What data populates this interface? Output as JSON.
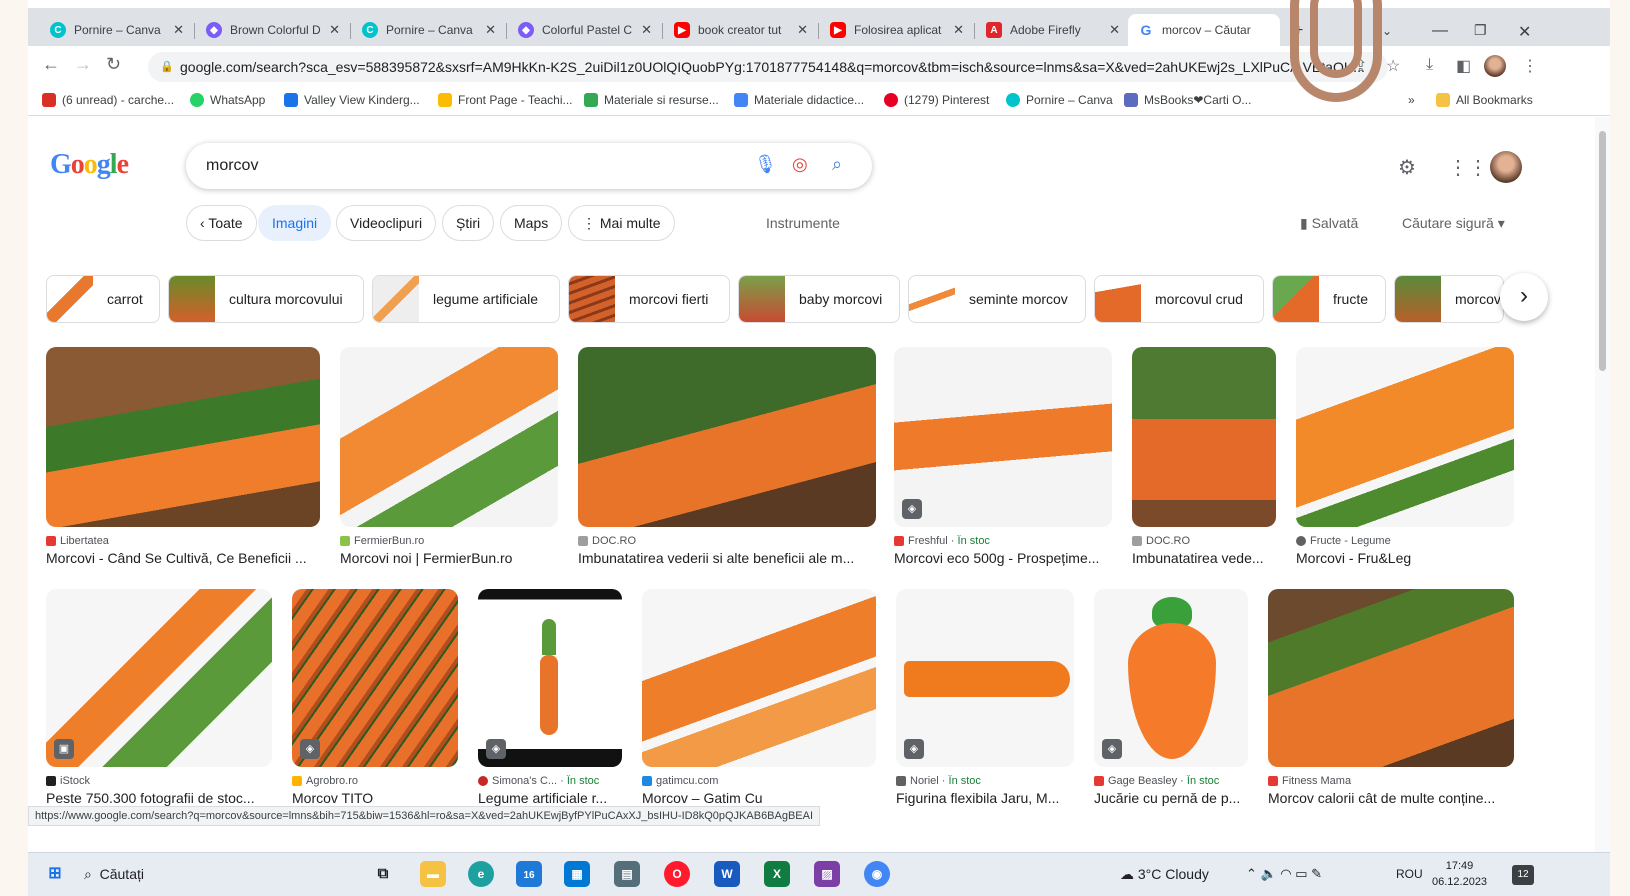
{
  "browser": {
    "tabs": [
      {
        "title": "Pornire – Canva",
        "icon_color": "#00c4cc"
      },
      {
        "title": "Brown Colorful D",
        "icon_color": "#7b5cf6"
      },
      {
        "title": "Pornire – Canva",
        "icon_color": "#00c4cc"
      },
      {
        "title": "Colorful Pastel C",
        "icon_color": "#7b5cf6"
      },
      {
        "title": "book creator tut",
        "icon_color": "#ff0000"
      },
      {
        "title": "Folosirea aplicat",
        "icon_color": "#ff0000"
      },
      {
        "title": "Adobe Firefly",
        "icon_color": "#e0262b"
      },
      {
        "title": "morcov – Căutar",
        "icon_color": "#4285f4",
        "active": true
      }
    ],
    "new_tab": "+",
    "url": "google.com/search?sca_esv=588395872&sxsrf=AM9HkKn-K2S_2uiDil1z0UOlQIQuobPYg:1701877754148&q=morcov&tbm=isch&source=lnms&sa=X&ved=2ahUKEwj2s_LXlPuCA VEtaQK...",
    "bookmarks": [
      {
        "label": "(6 unread) - carche...",
        "color": "#d93025"
      },
      {
        "label": "WhatsApp",
        "color": "#25d366"
      },
      {
        "label": "Valley View Kinderg...",
        "color": "#1a73e8"
      },
      {
        "label": "Front Page - Teachi...",
        "color": "#fbbc04"
      },
      {
        "label": "Materiale si resurse...",
        "color": "#34a853"
      },
      {
        "label": "Materiale didactice...",
        "color": "#4285f4"
      },
      {
        "label": "(1279) Pinterest",
        "color": "#e60023"
      },
      {
        "label": "Pornire – Canva",
        "color": "#00c4cc"
      },
      {
        "label": "MsBooks❤Carti O...",
        "color": "#5c6bc0"
      }
    ],
    "bookmarks_more": "»",
    "all_bookmarks": "All Bookmarks"
  },
  "google": {
    "logo": "Google",
    "query": "morcov",
    "filters": [
      "Toate",
      "Imagini",
      "Videoclipuri",
      "Știri",
      "Maps",
      "Mai multe"
    ],
    "tools": "Instrumente",
    "saved": "Salvată",
    "safe_search": "Căutare sigură",
    "related": [
      {
        "label": "carrot",
        "color": "#e8782e"
      },
      {
        "label": "cultura morcovului",
        "color": "#7a9a3a"
      },
      {
        "label": "legume artificiale",
        "color": "#f0a050"
      },
      {
        "label": "morcovi fierti",
        "color": "#d4602a"
      },
      {
        "label": "baby morcovi",
        "color": "#c84a32"
      },
      {
        "label": "seminte morcov",
        "color": "#f08a3a"
      },
      {
        "label": "morcovul crud",
        "color": "#e46a2a"
      },
      {
        "label": "fructe",
        "color": "#6aa84f"
      },
      {
        "label": "morcov",
        "color": "#b8602a"
      }
    ],
    "results_row1": [
      {
        "source": "Libertatea",
        "stock": "",
        "title": "Morcovi - Când Se Cultivă, Ce Beneficii ...",
        "bg": "#7a4a2a",
        "icon": "#e53935"
      },
      {
        "source": "FermierBun.ro",
        "stock": "",
        "title": "Morcovi noi | FermierBun.ro",
        "bg": "#f4f4f4",
        "icon": "#8bc34a"
      },
      {
        "source": "DOC.RO",
        "stock": "",
        "title": "Imbunatatirea vederii si alte beneficii ale m...",
        "bg": "#3e6b2a",
        "icon": "#9e9e9e"
      },
      {
        "source": "Freshful",
        "stock": "În stoc",
        "title": "Morcovi eco 500g - Prospețime...",
        "bg": "#f4f4f4",
        "icon": "#e53935"
      },
      {
        "source": "DOC.RO",
        "stock": "",
        "title": "Imbunatatirea vede...",
        "bg": "#4e7a32",
        "icon": "#9e9e9e"
      },
      {
        "source": "Fructe - Legume",
        "stock": "",
        "title": "Morcovi - Fru&Leg",
        "bg": "#f6f6f6",
        "icon": "#616161"
      }
    ],
    "results_row2": [
      {
        "source": "iStock",
        "stock": "",
        "title": "Peste 750.300 fotografii de stoc...",
        "bg": "#f6f6f6",
        "icon": "#212121"
      },
      {
        "source": "Agrobro.ro",
        "stock": "",
        "title": "Morcov TITO",
        "bg": "#d9642a",
        "icon": "#ffb300"
      },
      {
        "source": "Simona's C...",
        "stock": "În stoc",
        "title": "Legume artificiale r...",
        "bg": "#ffffff",
        "icon": "#c62828"
      },
      {
        "source": "gatimcu.com",
        "stock": "",
        "title": "Morcov – Gatim Cu",
        "bg": "#f6f6f6",
        "icon": "#1e88e5"
      },
      {
        "source": "Noriel",
        "stock": "În stoc",
        "title": "Figurina flexibila Jaru, M...",
        "bg": "#f6f6f6",
        "icon": "#616161"
      },
      {
        "source": "Gage Beasley",
        "stock": "În stoc",
        "title": "Jucărie cu pernă de p...",
        "bg": "#f6f6f6",
        "icon": "#e53935"
      },
      {
        "source": "Fitness Mama",
        "stock": "",
        "title": "Morcov calorii cât de multe conține...",
        "bg": "#6b4a2e",
        "icon": "#e53935"
      }
    ],
    "status_url": "https://www.google.com/search?q=morcov&source=lmns&bih=715&biw=1536&hl=ro&sa=X&ved=2ahUKEwjByfPYlPuCAxXJ_bsIHU-ID8kQ0pQJKAB6BAgBEAI"
  },
  "taskbar": {
    "search": "Căutați",
    "weather": "3°C  Cloudy",
    "lang": "ROU",
    "time": "17:49",
    "date": "06.12.2023",
    "notif": "12",
    "edge_badge": "16"
  }
}
